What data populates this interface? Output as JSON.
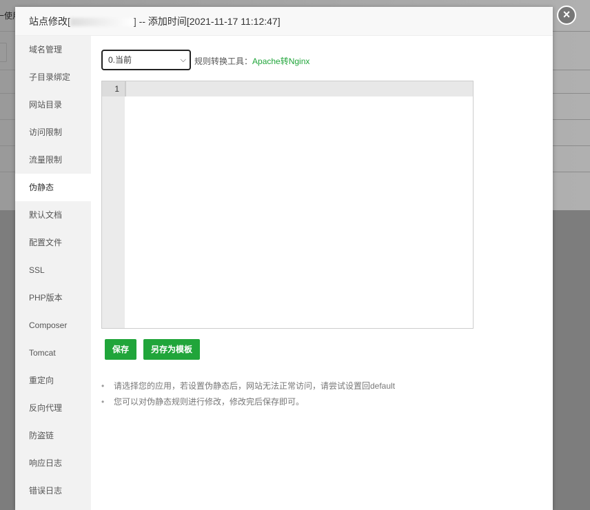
{
  "background": {
    "text": "一使用"
  },
  "dialog": {
    "title_prefix": "站点修改[",
    "title_suffix": "] -- 添加时间[2021-11-17 11:12:47]",
    "close_icon": "×"
  },
  "sidebar": {
    "items": [
      {
        "label": "域名管理"
      },
      {
        "label": "子目录绑定"
      },
      {
        "label": "网站目录"
      },
      {
        "label": "访问限制"
      },
      {
        "label": "流量限制"
      },
      {
        "label": "伪静态",
        "active": true
      },
      {
        "label": "默认文档"
      },
      {
        "label": "配置文件"
      },
      {
        "label": "SSL"
      },
      {
        "label": "PHP版本"
      },
      {
        "label": "Composer"
      },
      {
        "label": "Tomcat"
      },
      {
        "label": "重定向"
      },
      {
        "label": "反向代理"
      },
      {
        "label": "防盗链"
      },
      {
        "label": "响应日志"
      },
      {
        "label": "错误日志"
      }
    ]
  },
  "main": {
    "select_value": "0.当前",
    "tool_label": "规则转换工具：",
    "tool_link": "Apache转Nginx",
    "editor": {
      "line_numbers": [
        "1"
      ]
    },
    "save_label": "保存",
    "save_template_label": "另存为模板",
    "tips": [
      "请选择您的应用，若设置伪静态后，网站无法正常访问，请尝试设置回default",
      "您可以对伪静态规则进行修改，修改完后保存即可。"
    ]
  },
  "colors": {
    "accent": "#20a53a"
  }
}
